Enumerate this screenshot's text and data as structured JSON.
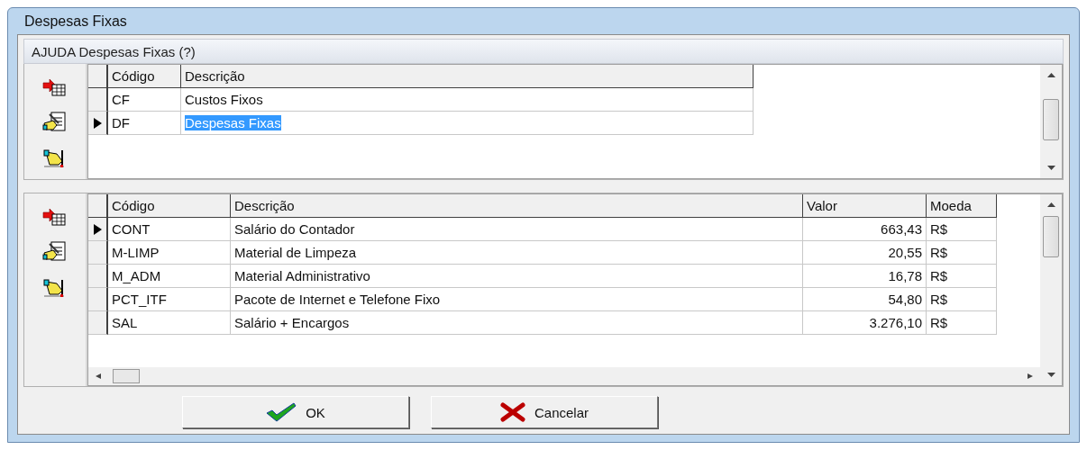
{
  "window": {
    "title": "Despesas Fixas"
  },
  "group": {
    "title": "AJUDA Despesas Fixas (?)"
  },
  "top_grid": {
    "columns": [
      {
        "label": "Código"
      },
      {
        "label": "Descrição"
      }
    ],
    "rows": [
      {
        "cells": [
          "CF",
          "Custos Fixos"
        ],
        "selected": false,
        "editing": false
      },
      {
        "cells": [
          "DF",
          "Despesas Fixas"
        ],
        "selected": true,
        "editing": true
      }
    ]
  },
  "bottom_grid": {
    "columns": [
      {
        "label": "Código"
      },
      {
        "label": "Descrição"
      },
      {
        "label": "Valor"
      },
      {
        "label": "Moeda"
      }
    ],
    "rows": [
      {
        "cells": [
          "CONT",
          "Salário do Contador",
          "663,43",
          "R$"
        ],
        "selected": true
      },
      {
        "cells": [
          "M-LIMP",
          "Material de Limpeza",
          "20,55",
          "R$"
        ],
        "selected": false
      },
      {
        "cells": [
          "M_ADM",
          "Material Administrativo",
          "16,78",
          "R$"
        ],
        "selected": false
      },
      {
        "cells": [
          "PCT_ITF",
          "Pacote de Internet e Telefone Fixo",
          "54,80",
          "R$"
        ],
        "selected": false
      },
      {
        "cells": [
          "SAL",
          "Salário + Encargos",
          "3.276,10",
          "R$"
        ],
        "selected": false
      }
    ]
  },
  "buttons": [
    {
      "label": "OK",
      "kind": "ok"
    },
    {
      "label": "Cancelar",
      "kind": "cancel"
    }
  ]
}
